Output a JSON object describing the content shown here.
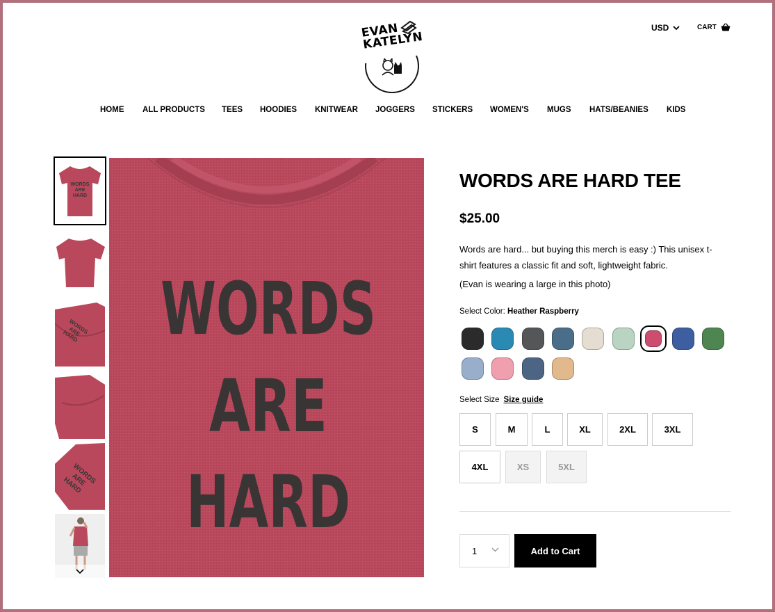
{
  "brand": {
    "logo_line1": "EVAN",
    "logo_line2": "KATELYN"
  },
  "header": {
    "currency": "USD",
    "cart_label": "CART"
  },
  "nav": [
    "HOME",
    "ALL PRODUCTS",
    "TEES",
    "HOODIES",
    "KNITWEAR",
    "JOGGERS",
    "STICKERS",
    "WOMEN'S",
    "MUGS",
    "HATS/BEANIES",
    "KIDS"
  ],
  "product": {
    "title": "WORDS ARE HARD TEE",
    "price": "$25.00",
    "description": "Words are hard... but buying this merch is easy :) This unisex t-shirt features a classic fit and soft, lightweight fabric.",
    "note": "(Evan is wearing a large in this photo)",
    "print_text": [
      "WORDS",
      "ARE",
      "HARD"
    ],
    "select_color_label": "Select Color:",
    "selected_color": "Heather Raspberry",
    "colors": [
      "#2b2b2b",
      "#2a8ab3",
      "#545658",
      "#4a6e8a",
      "#e6ddd2",
      "#b9d4c3",
      "#cd4d70",
      "#3e5ea2",
      "#4f8551",
      "#99aeca",
      "#ef9fad",
      "#4d6584",
      "#e2b98d"
    ],
    "select_size_label": "Select Size",
    "size_guide_label": "Size guide",
    "sizes": [
      {
        "label": "S",
        "available": true
      },
      {
        "label": "M",
        "available": true
      },
      {
        "label": "L",
        "available": true
      },
      {
        "label": "XL",
        "available": true
      },
      {
        "label": "2XL",
        "available": true
      },
      {
        "label": "3XL",
        "available": true
      },
      {
        "label": "4XL",
        "available": true
      },
      {
        "label": "XS",
        "available": false
      },
      {
        "label": "5XL",
        "available": false
      }
    ],
    "quantity": "1",
    "add_to_cart_label": "Add to Cart"
  },
  "colors": {
    "shirt": "#b9485c",
    "ink": "#3a3535",
    "frame": "#b26f7c"
  }
}
